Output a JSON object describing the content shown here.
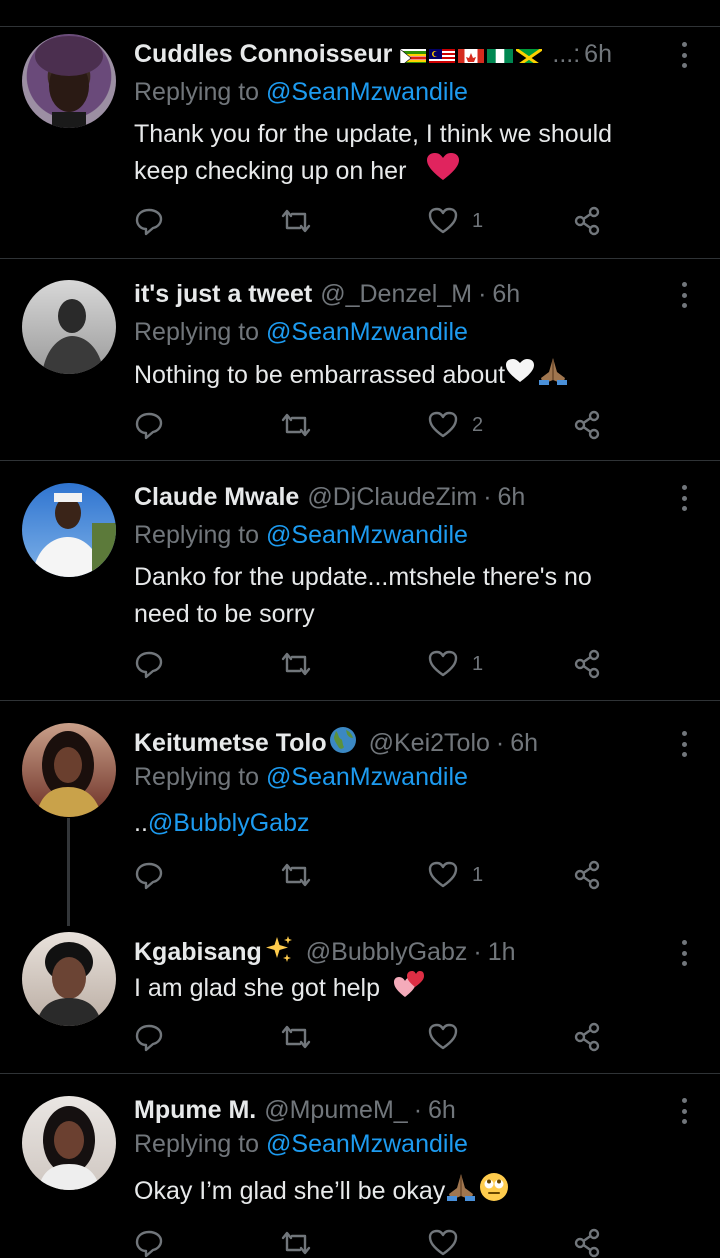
{
  "reply_prefix": "Replying to",
  "tweets": [
    {
      "name": "Cuddles Connoisseur",
      "handle": "",
      "truncation": "...:",
      "time": "6h",
      "replying_to": "@SeanMzwandile",
      "text_lines": [
        "Thank you for the update, I think we should",
        "keep checking up on her"
      ],
      "likes": "1",
      "avatar_color": "#6a4a7a"
    },
    {
      "name": "it's just a tweet",
      "handle": "@_Denzel_M",
      "time": "6h",
      "replying_to": "@SeanMzwandile",
      "text_lines": [
        "Nothing to be embarrassed about"
      ],
      "likes": "2",
      "avatar_color": "#888888"
    },
    {
      "name": "Claude Mwale",
      "handle": "@DjClaudeZim",
      "time": "6h",
      "replying_to": "@SeanMzwandile",
      "text_lines": [
        "Danko for the update...mtshele there's no",
        "need to be sorry"
      ],
      "likes": "1",
      "avatar_color": "#3a78c9"
    },
    {
      "name": "Keitumetse Tolo",
      "handle": "@Kei2Tolo",
      "time": "6h",
      "replying_to": "@SeanMzwandile",
      "text_prefix": "..",
      "text_mention": "@BubblyGabz",
      "likes": "1",
      "avatar_color": "#7a3b2e"
    },
    {
      "name": "Kgabisang",
      "handle": "@BubblyGabz",
      "time": "1h",
      "text_lines": [
        "I am glad she got help"
      ],
      "likes": "",
      "avatar_color": "#4a3a32"
    },
    {
      "name": "Mpume M.",
      "handle": "@MpumeM_",
      "time": "6h",
      "replying_to": "@SeanMzwandile",
      "text_lines": [
        "Okay I’m glad she’ll be okay"
      ],
      "likes": "",
      "avatar_color": "#5a3a2e"
    }
  ]
}
